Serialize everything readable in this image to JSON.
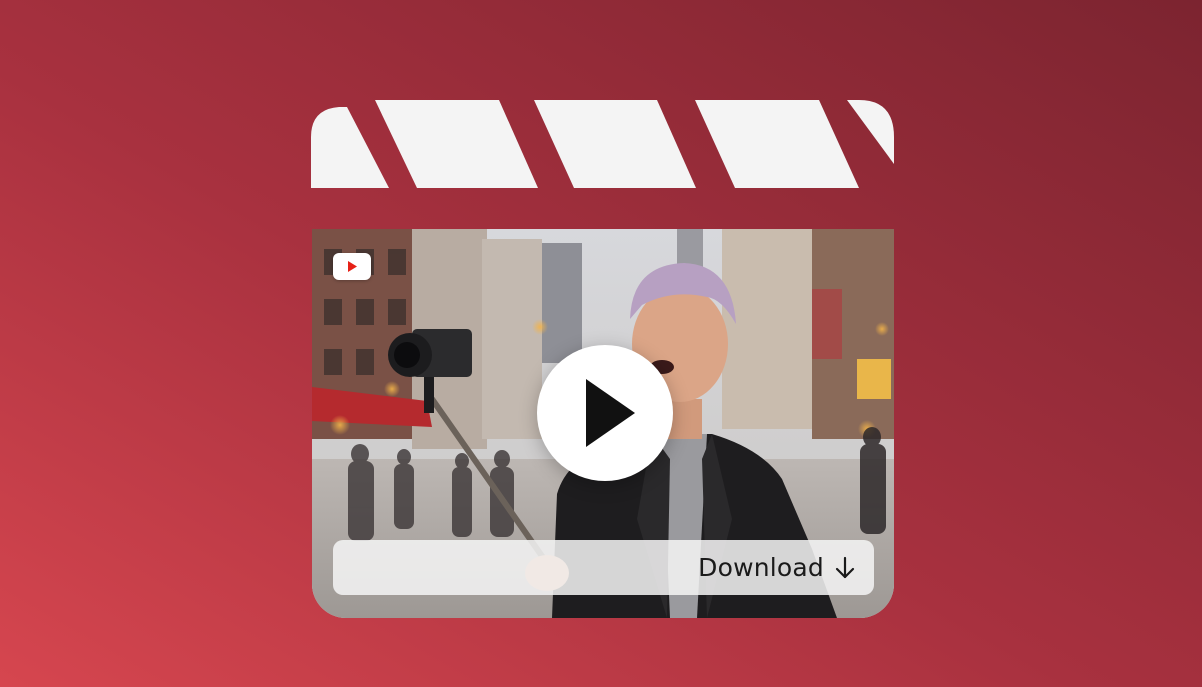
{
  "colors": {
    "background_light": "#d6464f",
    "background_dark": "#7c2430",
    "clapper": "#f4f4f4",
    "play_button": "#ffffff",
    "play_triangle": "#111111",
    "youtube_red": "#e62117"
  },
  "clapper": {
    "icon": "clapperboard-icon"
  },
  "video": {
    "badge_icon": "youtube-logo-icon",
    "play_icon": "play-icon"
  },
  "download": {
    "label": "Download",
    "icon": "arrow-down-icon"
  }
}
